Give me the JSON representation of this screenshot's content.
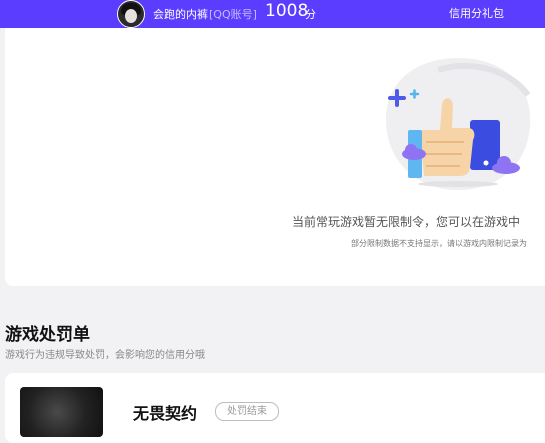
{
  "header": {
    "nickname": "会跑的内裤",
    "account_type": "[QQ账号]",
    "score": "1008",
    "score_unit": "分",
    "gift_link": "信用分礼包",
    "bg_color": "#5a3dff"
  },
  "restriction": {
    "main_text": "当前常玩游戏暂无限制令，您可以在游戏中",
    "sub_text": "部分限制数据不支持显示，请以游戏内限制记录为",
    "icon": "thumbs-up-illustration"
  },
  "penalty": {
    "title": "游戏处罚单",
    "description": "游戏行为违规导致处罚，会影响您的信用分哦",
    "items": [
      {
        "game": "无畏契约",
        "status": "处罚结束"
      }
    ]
  }
}
